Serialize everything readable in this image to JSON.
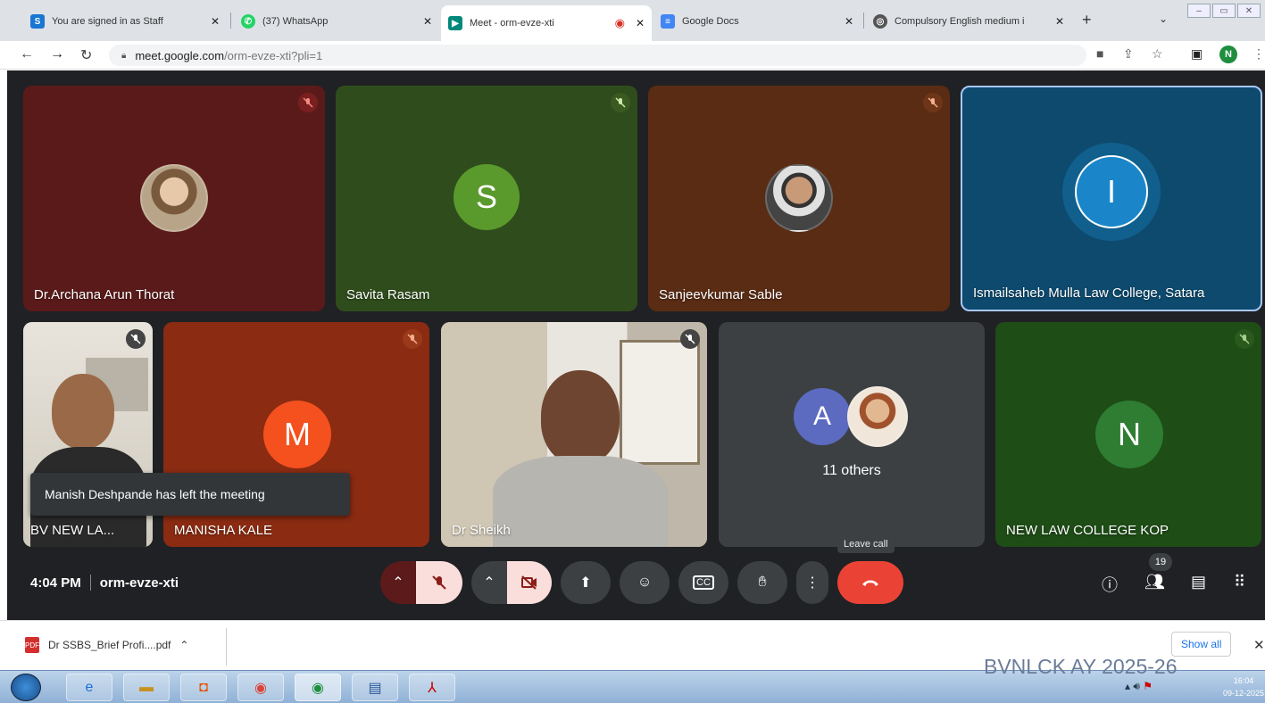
{
  "tabs": [
    {
      "label": "You are signed in as Staff",
      "icon": "s-icon",
      "color": "#1976d2"
    },
    {
      "label": "(37) WhatsApp",
      "icon": "whatsapp-icon",
      "color": "#25d366"
    },
    {
      "label": "Meet - orm-evze-xti",
      "icon": "meet-icon",
      "color": "#00897b",
      "active": true
    },
    {
      "label": "Google Docs",
      "icon": "docs-icon",
      "color": "#4285f4"
    },
    {
      "label": "Compulsory English medium i",
      "icon": "globe-icon",
      "color": "#555555"
    }
  ],
  "address": {
    "host": "meet.google.com",
    "path": "/orm-evze-xti?pli=1"
  },
  "profile_initial": "N",
  "participants": [
    {
      "name": "Dr.Archana Arun Thorat",
      "bg": "#5b1a1a"
    },
    {
      "name": "Savita Rasam",
      "initial": "S",
      "bg": "#2f4d1c",
      "avatar_color": "#5a9a2c"
    },
    {
      "name": "Sanjeevkumar Sable",
      "bg": "#5a2c14"
    },
    {
      "name": "Ismailsaheb Mulla Law College, Satara",
      "initial": "I",
      "bg": "#0d4a6e",
      "avatar_color": "#1a86c9"
    },
    {
      "name": "BV NEW LA..."
    },
    {
      "name": "MANISHA KALE",
      "initial": "M",
      "bg": "#8a2b12",
      "avatar_color": "#f4511e"
    },
    {
      "name": "Dr Sheikh"
    },
    {
      "name": "11 others",
      "initial": "A",
      "bg": "#3c4043",
      "avatar_color": "#5c6bc0"
    },
    {
      "name": "NEW LAW COLLEGE KOP",
      "initial": "N",
      "bg": "#1e4d16",
      "avatar_color": "#2e7d32"
    }
  ],
  "toast": "Manish Deshpande has left the meeting",
  "tooltip": "Leave call",
  "meeting": {
    "time": "4:04 PM",
    "code": "orm-evze-xti"
  },
  "people_count": "19",
  "download": {
    "file": "Dr SSBS_Brief Profi....pdf",
    "show_all": "Show all"
  },
  "taskbar_clock": {
    "time": "16:04",
    "date": "09-12-2025"
  },
  "watermark": "BVNLCK AY 2025-26"
}
